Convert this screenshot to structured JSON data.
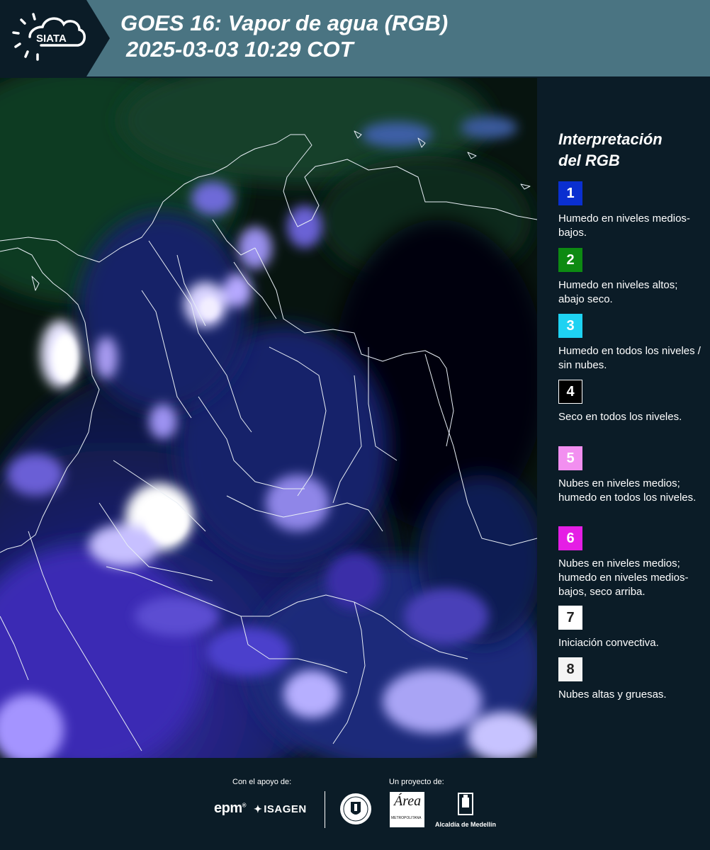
{
  "header": {
    "logo_text": "SIATA",
    "title_line1": "GOES 16: Vapor de agua (RGB)",
    "title_line2": "2025-03-03 10:29 COT"
  },
  "legend": {
    "title_line1": "Interpretación",
    "title_line2": "del RGB",
    "items": [
      {
        "num": "1",
        "color": "#0a2fd0",
        "text_color": "#ffffff",
        "desc": "Humedo en niveles medios-bajos."
      },
      {
        "num": "2",
        "color": "#0d8a12",
        "text_color": "#ffffff",
        "desc": "Humedo en niveles altos; abajo seco."
      },
      {
        "num": "3",
        "color": "#1ed2f2",
        "text_color": "#ffffff",
        "desc": "Humedo en todos los niveles / sin nubes."
      },
      {
        "num": "4",
        "color": "#000000",
        "text_color": "#ffffff",
        "desc": "Seco en todos los niveles."
      },
      {
        "num": "5",
        "color": "#f28ff0",
        "text_color": "#ffffff",
        "desc": "Nubes en niveles medios; humedo en todos los niveles."
      },
      {
        "num": "6",
        "color": "#e51ee5",
        "text_color": "#ffffff",
        "desc": "Nubes en niveles medios; humedo en niveles medios-bajos, seco arriba."
      },
      {
        "num": "7",
        "color": "#ffffff",
        "text_color": "#222222",
        "desc": "Iniciación convectiva."
      },
      {
        "num": "8",
        "color": "#f4f4f4",
        "text_color": "#222222",
        "desc": "Nubes altas y gruesas."
      }
    ]
  },
  "footer": {
    "support_label": "Con el apoyo de:",
    "project_label": "Un proyecto de:",
    "epm": "epm",
    "isagen": "ISAGEN",
    "area_title": "Área",
    "area_sub": "METROPOLITANA",
    "alcaldia": "Alcaldía de Medellín"
  }
}
